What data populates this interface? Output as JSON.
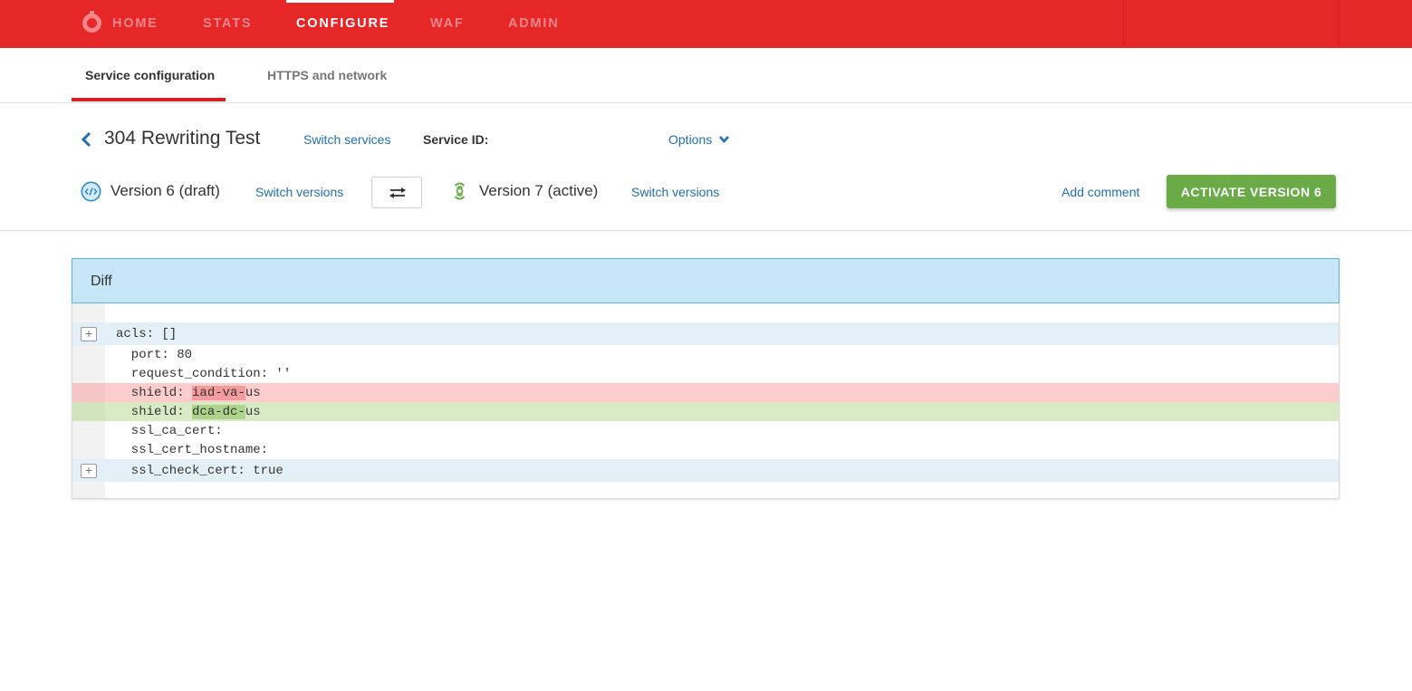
{
  "topnav": {
    "logo_icon": "stopwatch-logo-icon",
    "items": [
      {
        "label": "HOME",
        "active": false
      },
      {
        "label": "STATS",
        "active": false
      },
      {
        "label": "CONFIGURE",
        "active": true
      },
      {
        "label": "WAF",
        "active": false
      },
      {
        "label": "ADMIN",
        "active": false
      }
    ],
    "colors": {
      "background": "#e52727",
      "inactive_text": "#f7868b",
      "active_text": "#ffffff"
    }
  },
  "subtabs": [
    {
      "label": "Service configuration",
      "active": true
    },
    {
      "label": "HTTPS and network",
      "active": false
    }
  ],
  "service": {
    "back_icon": "chevron-left-icon",
    "title": "304 Rewriting Test",
    "switch_services_label": "Switch services",
    "service_id_label": "Service ID:",
    "service_id_value": "",
    "options_label": "Options",
    "options_icon": "chevron-down-icon"
  },
  "versions": {
    "draft": {
      "icon": "code-draft-icon",
      "label": "Version 6 (draft)",
      "switch_label": "Switch versions"
    },
    "swap_icon": "swap-arrows-icon",
    "active": {
      "icon": "active-broadcast-icon",
      "label": "Version 7 (active)",
      "switch_label": "Switch versions"
    },
    "add_comment_label": "Add comment",
    "activate_button_label": "ACTIVATE VERSION 6",
    "colors": {
      "link": "#1f6fb2",
      "activate_button": "#6aab47"
    }
  },
  "diff": {
    "title": "Diff",
    "lines": [
      {
        "type": "fold",
        "expand_label": "+",
        "text": "acls: []"
      },
      {
        "type": "context",
        "text": "  port: 80"
      },
      {
        "type": "context",
        "text": "  request_condition: ''"
      },
      {
        "type": "removed",
        "prefix": "  shield: ",
        "highlight": "iad-va-",
        "suffix": "us"
      },
      {
        "type": "added",
        "prefix": "  shield: ",
        "highlight": "dca-dc-",
        "suffix": "us"
      },
      {
        "type": "context",
        "text": "  ssl_ca_cert:"
      },
      {
        "type": "context",
        "text": "  ssl_cert_hostname:"
      },
      {
        "type": "fold",
        "expand_label": "+",
        "text": "  ssl_check_cert: true"
      }
    ],
    "colors": {
      "header_bg": "#c6e5f6",
      "removed_bg": "#fdcdcd",
      "removed_highlight": "#f49b9b",
      "added_bg": "#d9ebc5",
      "added_highlight": "#aed38b",
      "fold_bg": "#e3f0f7"
    }
  }
}
